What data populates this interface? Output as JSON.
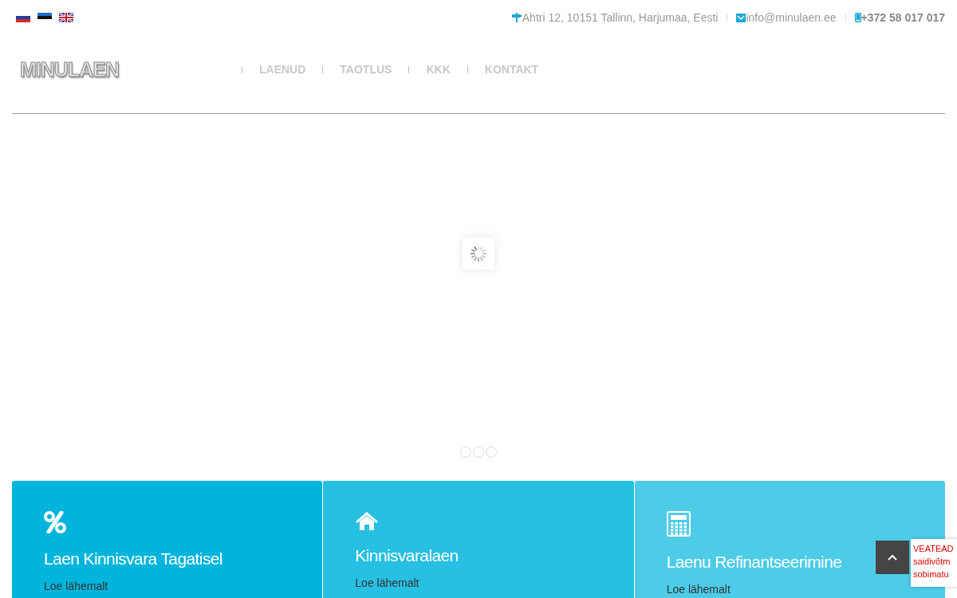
{
  "languages": [
    {
      "kind": "ru"
    },
    {
      "kind": "et"
    },
    {
      "kind": "en"
    }
  ],
  "contacts": [
    {
      "kind": "address",
      "text": "Ahtri 12, 10151 Tallinn, Harjumaa, Eesti"
    },
    {
      "kind": "email",
      "text": "info@minulaen.ee"
    },
    {
      "kind": "phone",
      "text": "+372 58 017 017"
    }
  ],
  "logo": "MINULAEN",
  "nav": [
    "LAENUD",
    "TAOTLUS",
    "KKK",
    "KONTAKT"
  ],
  "cards": [
    {
      "kind": "percent",
      "title": "Laen Kinnisvara Tagatisel",
      "link": "Loe lähemalt",
      "color": "#00b4dc"
    },
    {
      "kind": "home",
      "title": "Kinnisvaralaen",
      "link": "Loe lähemalt",
      "color": "#27bfe2"
    },
    {
      "kind": "calculator",
      "title": "Laenu Refinantseerimine",
      "link": "Loe lähemalt",
      "color": "#4dcce8"
    }
  ],
  "error_box": [
    "VEATEAD",
    "saidivõtm",
    "sobimatu"
  ]
}
